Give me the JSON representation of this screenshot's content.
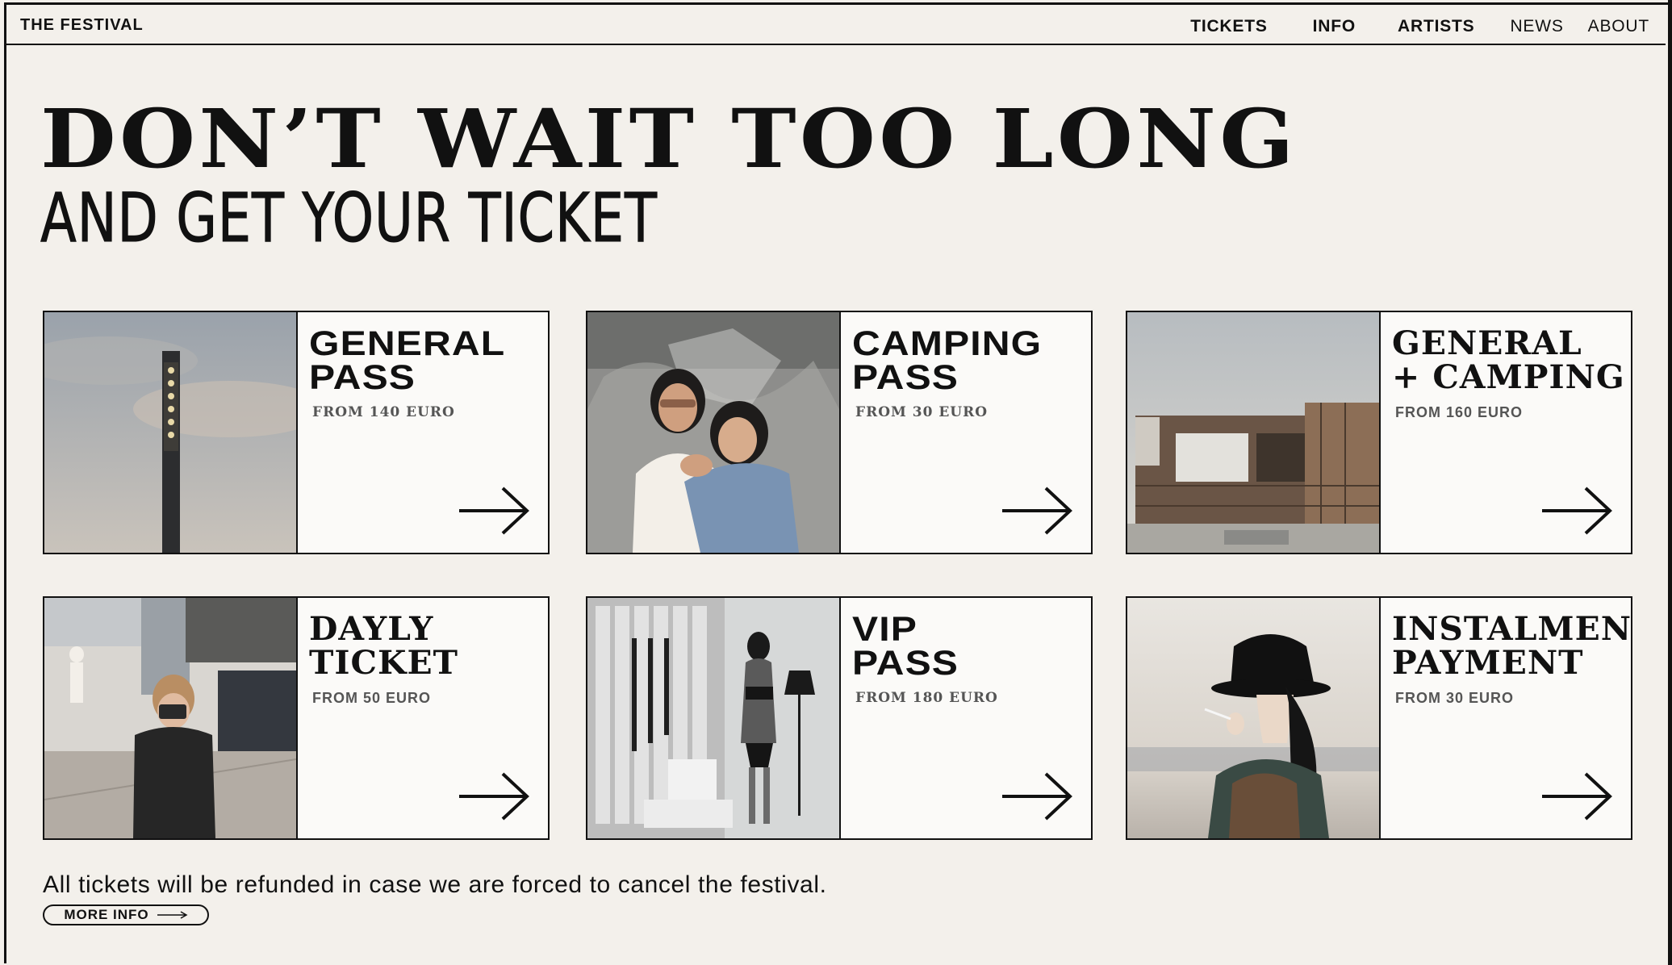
{
  "brand": "THE FESTIVAL",
  "nav": [
    {
      "label": "TICKETS"
    },
    {
      "label": "INFO"
    },
    {
      "label": "ARTISTS"
    },
    {
      "label": "NEWS"
    },
    {
      "label": "ABOUT"
    }
  ],
  "hero": {
    "headline": "DON’T WAIT TOO LONG",
    "subhead": "AND GET YOUR TICKET"
  },
  "cards": [
    {
      "title": "GENERAL\nPASS",
      "price": "FROM 140 EURO",
      "photo_icon": "light-tower-icon"
    },
    {
      "title": "CAMPING\nPASS",
      "price": "FROM 30 EURO",
      "photo_icon": "friends-photo-icon"
    },
    {
      "title": "GENERAL\n+ CAMPING",
      "price": "FROM 160 EURO",
      "photo_icon": "building-photo-icon"
    },
    {
      "title": "DAYLY\nTICKET",
      "price": "FROM 50 EURO",
      "photo_icon": "camera-kid-photo-icon"
    },
    {
      "title": "VIP\nPASS",
      "price": "FROM 180 EURO",
      "photo_icon": "mannequin-photo-icon"
    },
    {
      "title": "INSTALMENT\nPAYMENT",
      "price": "FROM 30 EURO",
      "photo_icon": "woman-hat-photo-icon"
    }
  ],
  "footer": {
    "note": "All tickets will be refunded in case we are forced to cancel the festival.",
    "more_label": "MORE INFO"
  }
}
